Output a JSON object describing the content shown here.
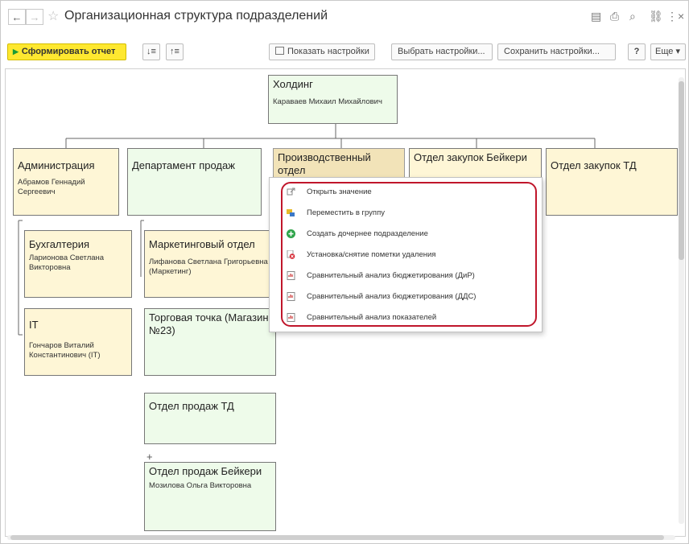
{
  "window": {
    "title": "Организационная структура подразделений",
    "back_icon": "←",
    "forward_icon": "→",
    "favorite_icon": "☆",
    "title_icons": [
      "▤",
      "⎙",
      "⌕",
      "⛓",
      "⋮",
      "×"
    ]
  },
  "toolbar": {
    "generate_label": "Сформировать отчет",
    "show_settings_label": "Показать настройки",
    "choose_settings_label": "Выбрать настройки...",
    "save_settings_label": "Сохранить настройки...",
    "help_label": "?",
    "more_label": "Еще ▾",
    "sort_icon_1": "↓≡",
    "sort_icon_2": "↑≡",
    "accent_color": "#fee830"
  },
  "org": {
    "root": {
      "name": "Холдинг",
      "person": "Караваев Михаил Михайлович"
    },
    "admin": {
      "name": "Администрация",
      "person": "Абрамов Геннадий Сергеевич"
    },
    "sales_dept": {
      "name": "Департамент продаж",
      "person": ""
    },
    "production": {
      "name": "Производственный отдел",
      "person": ""
    },
    "purchasing_baykeri": {
      "name": "Отдел закупок Бейкери",
      "person": ""
    },
    "purchasing_td": {
      "name": "Отдел закупок ТД",
      "person": ""
    },
    "accounting": {
      "name": "Бухгалтерия",
      "person": "Ларионова Светлана Викторовна"
    },
    "it": {
      "name": "IT",
      "person": "Гончаров Виталий Константинович (IT)"
    },
    "marketing": {
      "name": "Маркетинговый отдел",
      "person": "Лифанова Светлана Григорьевна (Маркетинг)"
    },
    "retail_point": {
      "name": "Торговая точка (Магазин №23)",
      "person": ""
    },
    "sales_td": {
      "name": "Отдел продаж ТД",
      "person": ""
    },
    "sales_baykeri": {
      "name": "Отдел продаж Бейкери",
      "person": "Мозилова Ольга Викторовна"
    },
    "expand_symbol": "+"
  },
  "context_menu": {
    "items": [
      {
        "label": "Открыть значение",
        "icon": "open-icon"
      },
      {
        "label": "Переместить в группу",
        "icon": "move-group-icon"
      },
      {
        "label": "Создать дочернее подразделение",
        "icon": "add-child-icon"
      },
      {
        "label": "Установка/снятие пометки удаления",
        "icon": "delete-mark-icon"
      },
      {
        "label": "Сравнительный анализ бюджетирования (ДиР)",
        "icon": "report-icon"
      },
      {
        "label": "Сравнительный анализ бюджетирования (ДДС)",
        "icon": "report-icon"
      },
      {
        "label": "Сравнительный анализ показателей",
        "icon": "report-icon"
      }
    ],
    "highlight_color": "#c0162b"
  }
}
